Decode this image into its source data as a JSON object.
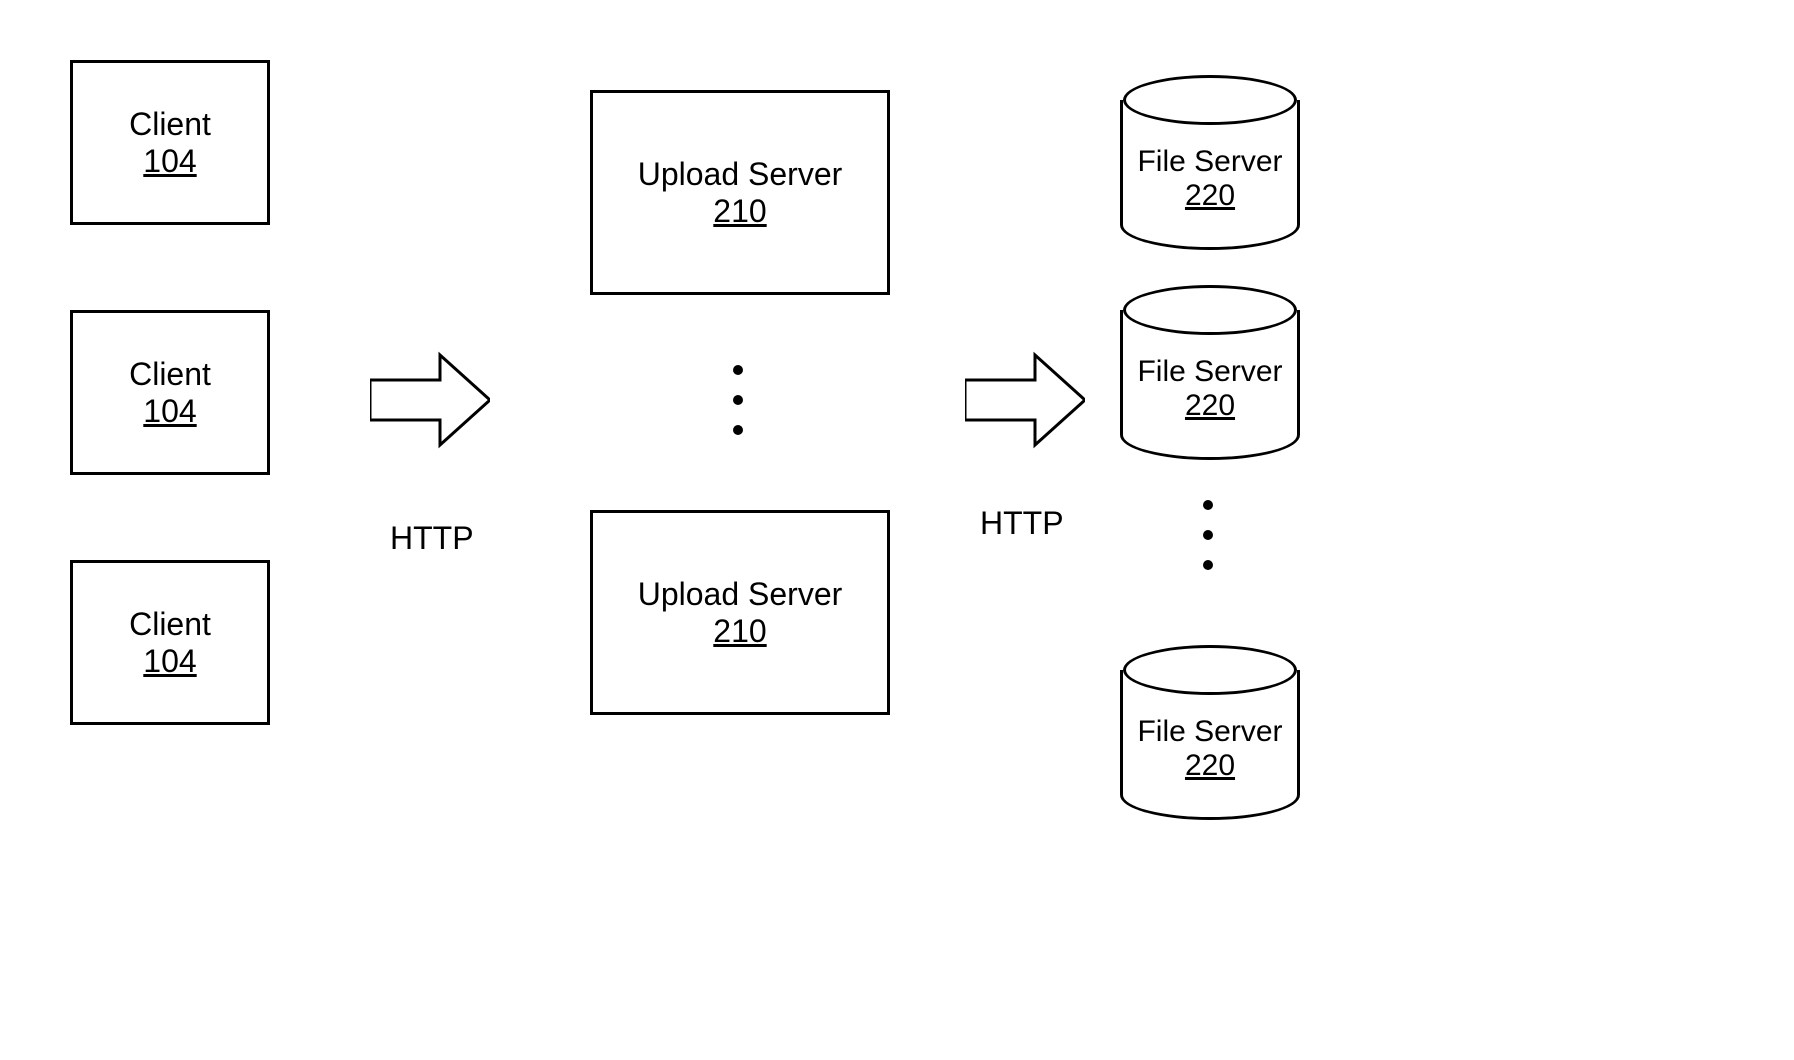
{
  "clients": [
    {
      "label": "Client",
      "number": "104"
    },
    {
      "label": "Client",
      "number": "104"
    },
    {
      "label": "Client",
      "number": "104"
    }
  ],
  "upload_servers": [
    {
      "label": "Upload Server",
      "number": "210"
    },
    {
      "label": "Upload Server",
      "number": "210"
    }
  ],
  "file_servers": [
    {
      "label": "File Server",
      "number": "220"
    },
    {
      "label": "File Server",
      "number": "220"
    },
    {
      "label": "File Server",
      "number": "220"
    }
  ],
  "arrows": {
    "left_label": "HTTP",
    "right_label": "HTTP"
  }
}
